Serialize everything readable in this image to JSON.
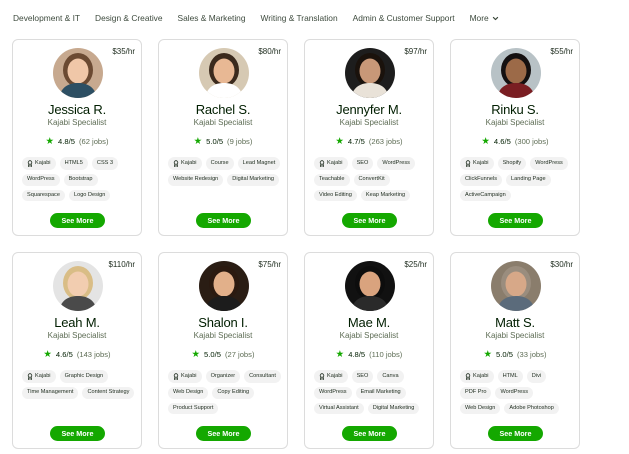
{
  "nav": {
    "items": [
      "Development & IT",
      "Design & Creative",
      "Sales & Marketing",
      "Writing & Translation",
      "Admin & Customer Support",
      "More"
    ]
  },
  "colors": {
    "accent": "#14a800",
    "tag_bg": "#f2f2f2",
    "card_border": "#dcdcdc"
  },
  "cards": [
    {
      "rate": "$35/hr",
      "name": "Jessica R.",
      "title": "Kajabi Specialist",
      "score": "4.8/5",
      "jobs": "(62 jobs)",
      "tags": [
        "Kajabi",
        "HTML5",
        "CSS 3",
        "WordPress",
        "Bootstrap",
        "Squarespace",
        "Logo Design"
      ],
      "button": "See More",
      "avatar": {
        "bg": "#c7a98f",
        "hair": "#6b4a32",
        "skin": "#f0c7a8",
        "shirt": "#2d4f63"
      }
    },
    {
      "rate": "$80/hr",
      "name": "Rachel S.",
      "title": "Kajabi Specialist",
      "score": "5.0/5",
      "jobs": "(9 jobs)",
      "tags": [
        "Kajabi",
        "Course",
        "Lead Magnet",
        "Website Redesign",
        "Digital Marketing"
      ],
      "button": "See More",
      "avatar": {
        "bg": "#d6c9b3",
        "hair": "#3b2a1d",
        "skin": "#e8b894",
        "shirt": "#ffffff"
      }
    },
    {
      "rate": "$97/hr",
      "name": "Jennyfer M.",
      "title": "Kajabi Specialist",
      "score": "4.7/5",
      "jobs": "(263 jobs)",
      "tags": [
        "Kajabi",
        "SEO",
        "WordPress",
        "Teachable",
        "ConvertKit",
        "Video Editing",
        "Keap Marketing"
      ],
      "button": "See More",
      "avatar": {
        "bg": "#1d1d1d",
        "hair": "#1a120c",
        "skin": "#c89878",
        "shirt": "#e9e2d8"
      }
    },
    {
      "rate": "$55/hr",
      "name": "Rinku S.",
      "title": "Kajabi Specialist",
      "score": "4.6/5",
      "jobs": "(300 jobs)",
      "tags": [
        "Kajabi",
        "Shopify",
        "WordPress",
        "ClickFunnels",
        "Landing Page",
        "ActiveCampaign"
      ],
      "button": "See More",
      "avatar": {
        "bg": "#b8c2c6",
        "hair": "#141010",
        "skin": "#9c6a48",
        "shirt": "#7a1e22"
      }
    },
    {
      "rate": "$110/hr",
      "name": "Leah M.",
      "title": "Kajabi Specialist",
      "score": "4.6/5",
      "jobs": "(143 jobs)",
      "tags": [
        "Kajabi",
        "Graphic Design",
        "Time Management",
        "Content Strategy"
      ],
      "button": "See More",
      "avatar": {
        "bg": "#e4e4e4",
        "hair": "#d9bd86",
        "skin": "#f2cdb0",
        "shirt": "#4a4a4a"
      }
    },
    {
      "rate": "$75/hr",
      "name": "Shalon I.",
      "title": "Kajabi Specialist",
      "score": "5.0/5",
      "jobs": "(27 jobs)",
      "tags": [
        "Kajabi",
        "Organizer",
        "Consultant",
        "Web Design",
        "Copy Editing",
        "Product Support"
      ],
      "button": "See More",
      "avatar": {
        "bg": "#2a1d14",
        "hair": "#2b1a10",
        "skin": "#e2b08a",
        "shirt": "#1c1c1c"
      }
    },
    {
      "rate": "$25/hr",
      "name": "Mae M.",
      "title": "Kajabi Specialist",
      "score": "4.8/5",
      "jobs": "(110 jobs)",
      "tags": [
        "Kajabi",
        "SEO",
        "Canva",
        "WordPress",
        "Email Marketing",
        "Virtual Assistant",
        "Digital Marketing"
      ],
      "button": "See More",
      "avatar": {
        "bg": "#111111",
        "hair": "#0d0d0d",
        "skin": "#d9a37e",
        "shirt": "#2a2a2a"
      }
    },
    {
      "rate": "$30/hr",
      "name": "Matt S.",
      "title": "Kajabi Specialist",
      "score": "5.0/5",
      "jobs": "(33 jobs)",
      "tags": [
        "Kajabi",
        "HTML",
        "Divi",
        "PDF Pro",
        "WordPress",
        "Web Design",
        "Adobe Photoshop"
      ],
      "button": "See More",
      "avatar": {
        "bg": "#8a7d6c",
        "hair": "#9a8d7e",
        "skin": "#d7a888",
        "shirt": "#5b6b7b"
      }
    }
  ]
}
